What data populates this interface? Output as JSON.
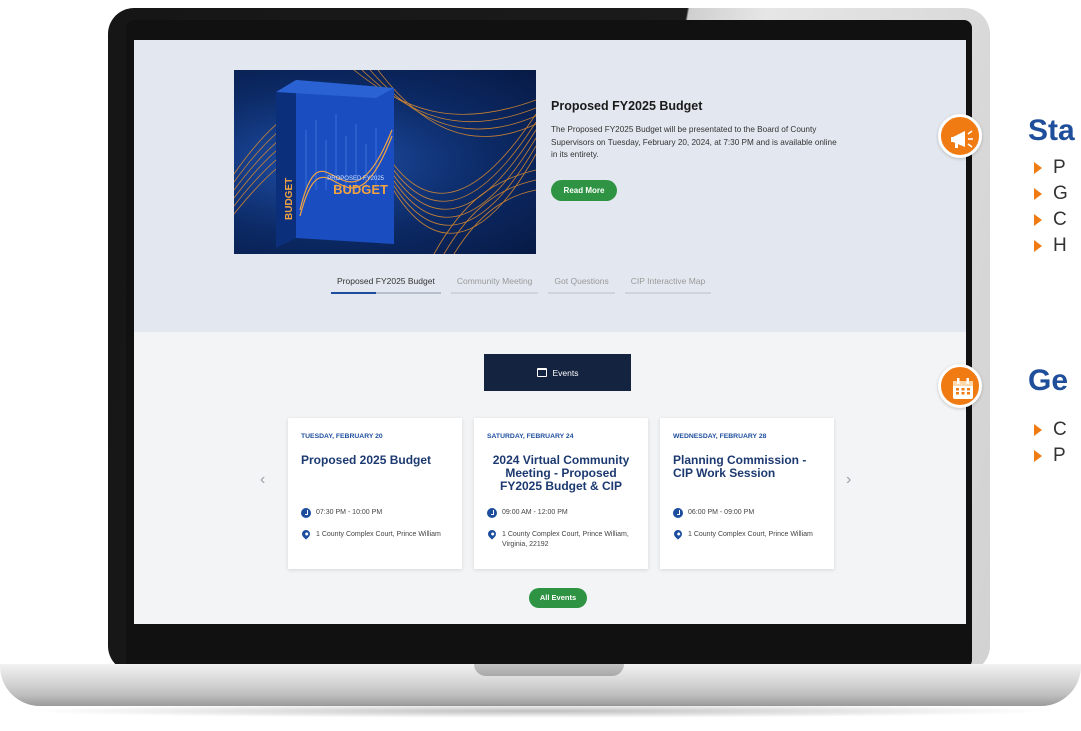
{
  "hero": {
    "title": "Proposed FY2025 Budget",
    "description": "The Proposed FY2025 Budget will be presentated to the Board of County Supervisors on Tuesday, February 20, 2024, at 7:30 PM and is available online in its  entirety.",
    "read_more": "Read More",
    "image_text": {
      "spine": "BUDGET",
      "small": "PROPOSED FY2025",
      "big": "BUDGET"
    }
  },
  "tabs": [
    {
      "label": "Proposed FY2025 Budget",
      "active": true
    },
    {
      "label": "Community Meeting",
      "active": false
    },
    {
      "label": "Got Questions",
      "active": false
    },
    {
      "label": "CIP Interactive Map",
      "active": false
    }
  ],
  "events": {
    "header_label": "Events",
    "all_events": "All Events",
    "prev_icon": "chevron-left-icon",
    "next_icon": "chevron-right-icon",
    "cards": [
      {
        "date": "TUESDAY, FEBRUARY 20",
        "title": "Proposed 2025 Budget",
        "time": "07:30 PM - 10:00 PM",
        "location": "1 County Complex Court, Prince William"
      },
      {
        "date": "SATURDAY, FEBRUARY 24",
        "title": "2024 Virtual Community Meeting - Proposed FY2025 Budget & CIP",
        "time": "09:00 AM - 12:00 PM",
        "location": "1 County Complex Court, Prince William, Virginia, 22192"
      },
      {
        "date": "WEDNESDAY, FEBRUARY 28",
        "title": "Planning Commission - CIP Work Session",
        "time": "06:00 PM - 09:00 PM",
        "location": "1 County Complex Court, Prince William"
      }
    ]
  },
  "overlay": {
    "section1": {
      "heading": "Sta",
      "items": [
        "P",
        "G",
        "C",
        "H"
      ],
      "icon": "megaphone-icon"
    },
    "section2": {
      "heading": "Ge",
      "items": [
        "C",
        "P"
      ],
      "icon": "calendar-icon"
    },
    "accent_color": "#f07b12",
    "heading_color": "#1f4e9a"
  },
  "colors": {
    "navy": "#14233f",
    "green_button": "#2e9443",
    "link_blue": "#1d4e9e",
    "hero_bg": "#e3e8f0"
  }
}
